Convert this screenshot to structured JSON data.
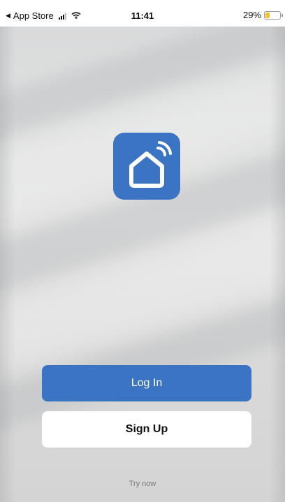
{
  "status_bar": {
    "back_label": "App Store",
    "time": "11:41",
    "battery_text": "29%",
    "battery_level": 0.29,
    "battery_color": "#f2c230"
  },
  "app": {
    "icon": "smart-home-wifi-icon",
    "icon_bg_color": "#3a74c2"
  },
  "actions": {
    "login_label": "Log In",
    "signup_label": "Sign Up",
    "try_now_label": "Try now"
  },
  "colors": {
    "primary": "#3a74c2",
    "secondary_button": "#ffffff"
  }
}
